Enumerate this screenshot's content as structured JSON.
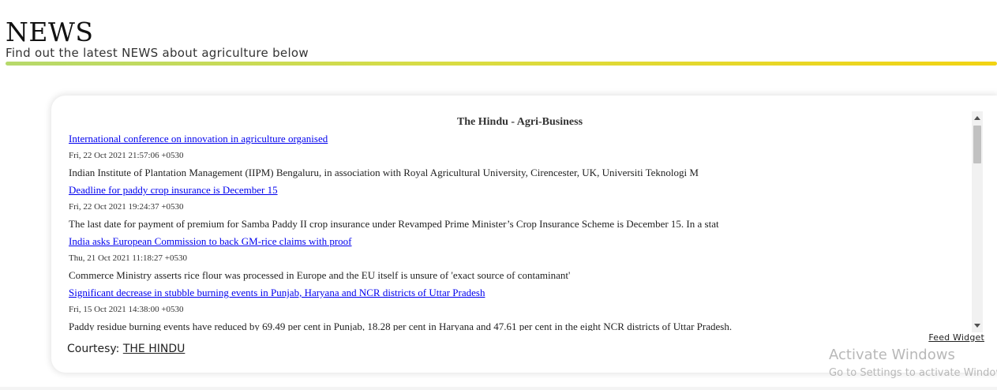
{
  "header": {
    "title": "NEWS",
    "subtitle": "Find out the latest NEWS about agriculture below"
  },
  "feed": {
    "title": "The Hindu - Agri-Business",
    "items": [
      {
        "title": "International conference on innovation in agriculture organised",
        "date": "Fri, 22 Oct 2021 21:57:06 +0530",
        "description": "Indian Institute of Plantation Management (IIPM) Bengaluru, in association with Royal Agricultural University, Cirencester, UK, Universiti Teknologi M"
      },
      {
        "title": "Deadline for paddy crop insurance is December 15",
        "date": "Fri, 22 Oct 2021 19:24:37 +0530",
        "description": "The last date for payment of premium for Samba Paddy II crop insurance under Revamped Prime Minister’s Crop Insurance Scheme is December 15. In a stat"
      },
      {
        "title": "India asks European Commission to back GM-rice claims with proof",
        "date": "Thu, 21 Oct 2021 11:18:27 +0530",
        "description": "Commerce Ministry asserts rice flour was processed in Europe and the EU itself is unsure of 'exact source of contaminant'"
      },
      {
        "title": "Significant decrease in stubble burning events in Punjab, Haryana and NCR districts of Uttar Pradesh",
        "date": "Fri, 15 Oct 2021 14:38:00 +0530",
        "description": "Paddy residue burning events have reduced by 69.49 per cent in Punjab, 18.28 per cent in Haryana and 47.61 per cent in the eight NCR districts of Uttar Pradesh."
      }
    ],
    "widget_link": "Feed Widget"
  },
  "courtesy": {
    "label": "Courtesy:",
    "link": "THE HINDU"
  },
  "watermark": {
    "title": "Activate Windows",
    "subtitle": "Go to Settings to activate Windows."
  },
  "colors": {
    "link": "#0000ee",
    "divider_start": "#b6d96b",
    "divider_end": "#f2d313"
  }
}
